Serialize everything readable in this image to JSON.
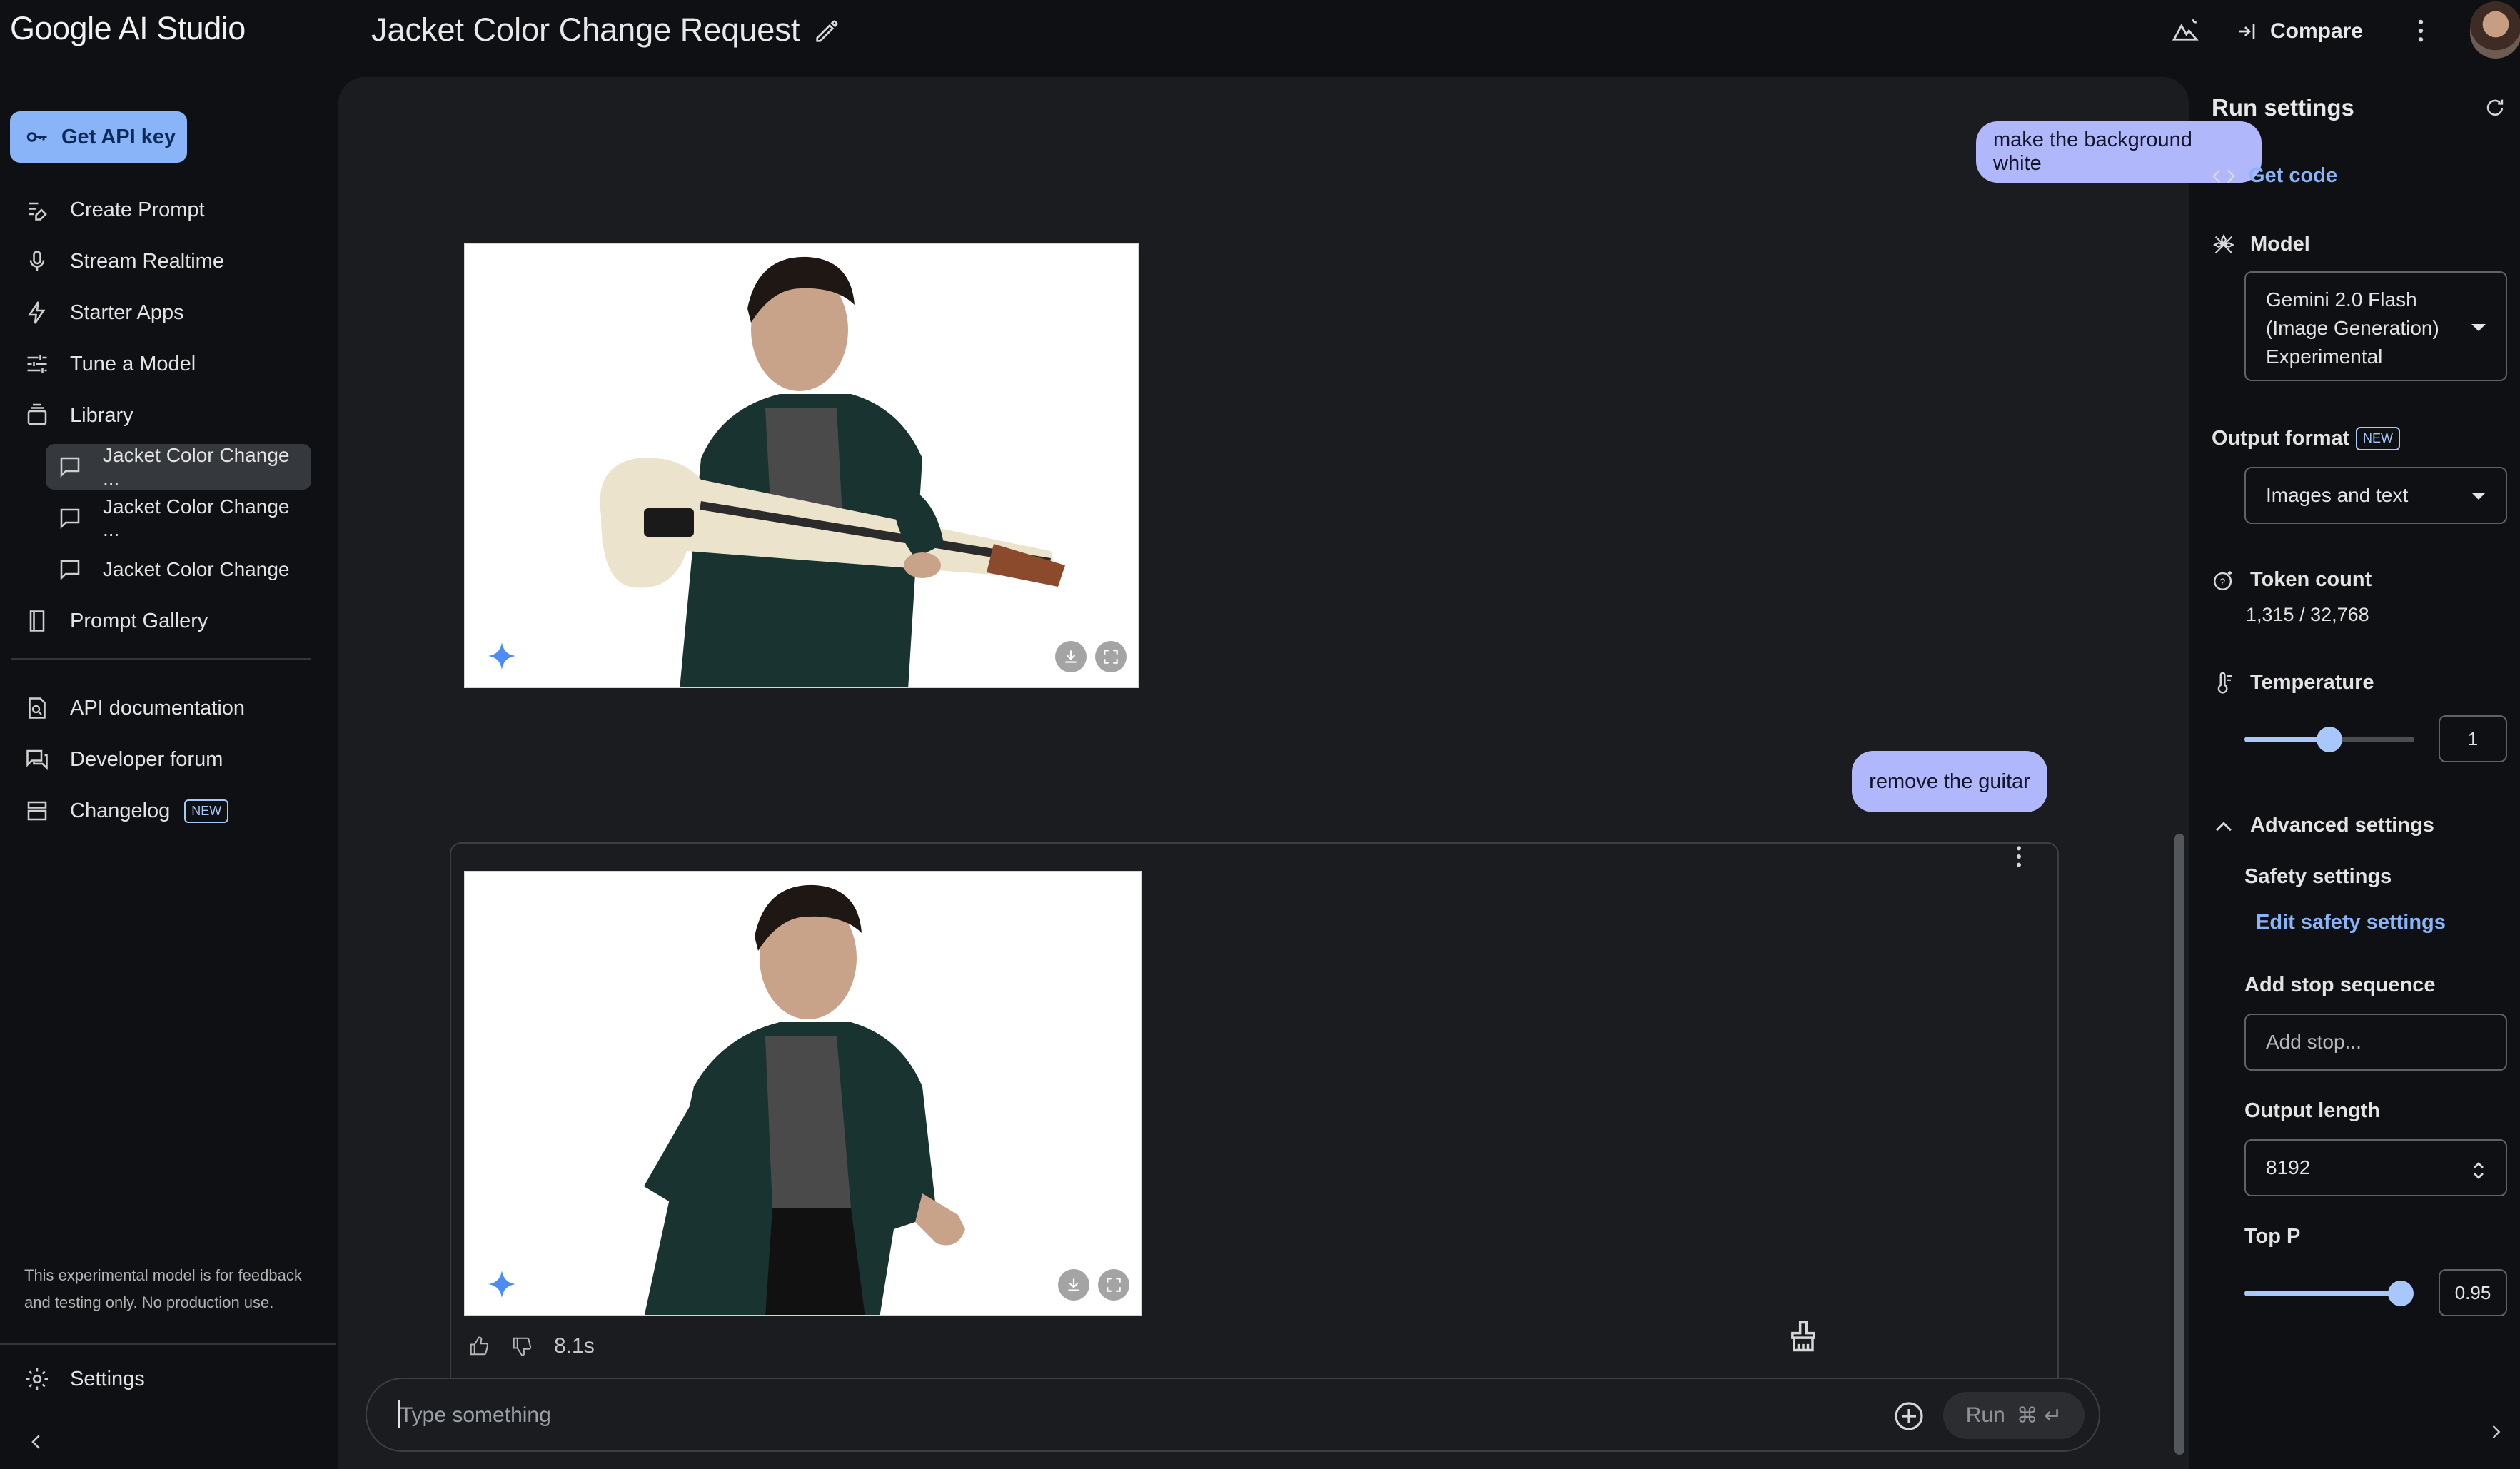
{
  "header": {
    "brand": "Google AI Studio",
    "title": "Jacket Color Change Request",
    "compare_label": "Compare"
  },
  "sidebar": {
    "api_key_label": "Get API key",
    "items": [
      {
        "label": "Create Prompt",
        "icon": "create-prompt-icon"
      },
      {
        "label": "Stream Realtime",
        "icon": "mic-icon"
      },
      {
        "label": "Starter Apps",
        "icon": "bolt-icon"
      },
      {
        "label": "Tune a Model",
        "icon": "tune-icon"
      },
      {
        "label": "Library",
        "icon": "library-icon"
      }
    ],
    "library_items": [
      {
        "label": "Jacket Color Change ..."
      },
      {
        "label": "Jacket Color Change ..."
      },
      {
        "label": "Jacket Color Change"
      }
    ],
    "prompt_gallery_label": "Prompt Gallery",
    "links": [
      {
        "label": "API documentation"
      },
      {
        "label": "Developer forum"
      },
      {
        "label": "Changelog",
        "badge": "NEW"
      }
    ],
    "disclaimer": "This experimental model is for feedback and testing only. No production use.",
    "settings_label": "Settings"
  },
  "chat": {
    "user_msg_1": "make the background white",
    "user_msg_2": "remove the guitar",
    "response_time": "8.1s",
    "input_placeholder": "Type something",
    "run_label": "Run",
    "run_shortcut": "⌘ ↵"
  },
  "run_settings": {
    "title": "Run settings",
    "get_code": "Get code",
    "model_label": "Model",
    "model_value_line1": "Gemini 2.0 Flash",
    "model_value_line2": "(Image Generation)",
    "model_value_line3": "Experimental",
    "output_format_label": "Output format",
    "output_format_badge": "NEW",
    "output_format_value": "Images and text",
    "token_count_label": "Token count",
    "token_count_value": "1,315 / 32,768",
    "temperature_label": "Temperature",
    "temperature_value": "1",
    "temperature_fraction": 0.5,
    "advanced_label": "Advanced settings",
    "safety_label": "Safety settings",
    "edit_safety": "Edit safety settings",
    "stop_seq_label": "Add stop sequence",
    "stop_seq_placeholder": "Add stop...",
    "output_length_label": "Output length",
    "output_length_value": "8192",
    "top_p_label": "Top P",
    "top_p_value": "0.95",
    "top_p_fraction": 0.95
  }
}
